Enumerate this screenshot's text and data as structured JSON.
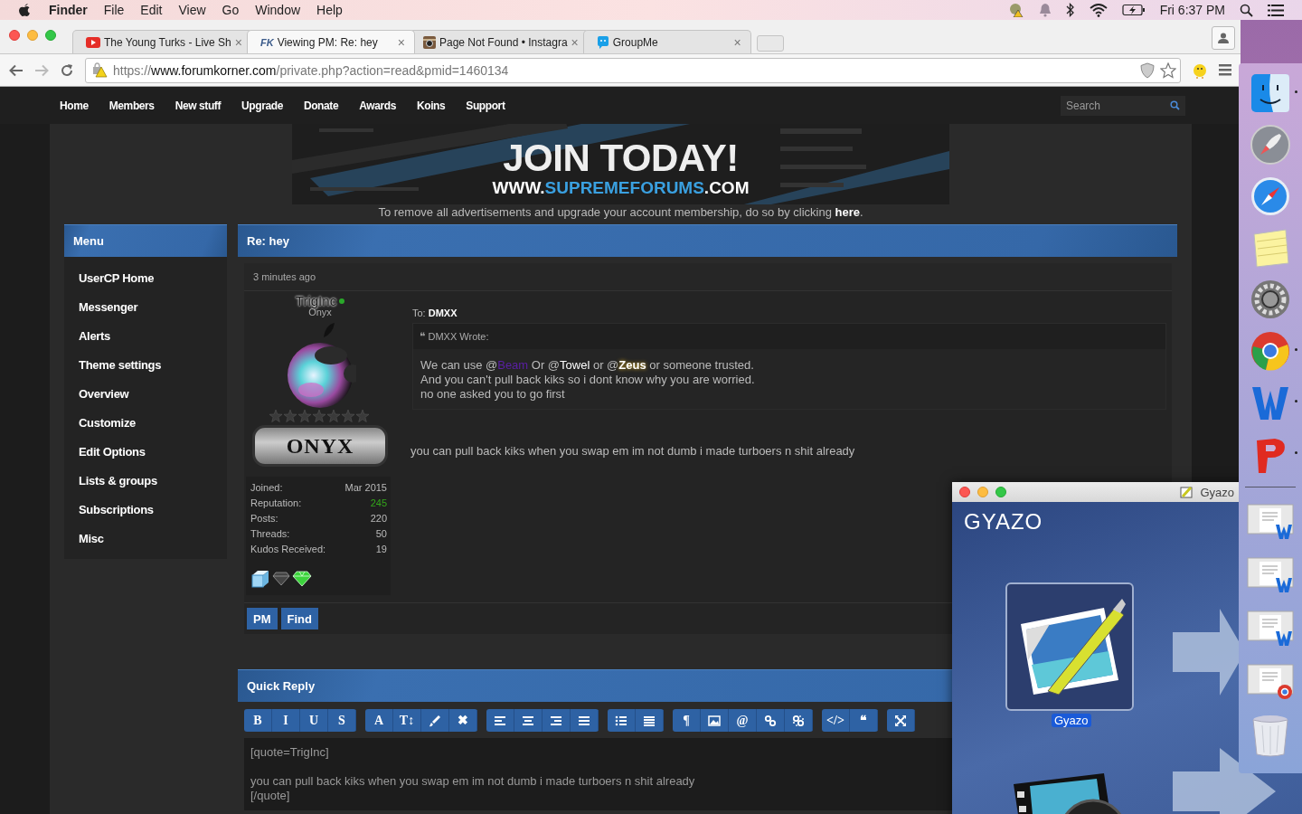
{
  "menubar": {
    "app": "Finder",
    "menus": [
      "File",
      "Edit",
      "View",
      "Go",
      "Window",
      "Help"
    ],
    "clock": "Fri 6:37 PM"
  },
  "browser": {
    "tabs": [
      {
        "title": "The Young Turks - Live Sh",
        "kind": "video",
        "close": "×",
        "selected": false
      },
      {
        "title": "Viewing PM: Re: hey",
        "kind": "monogram",
        "mark": "FK",
        "close": "×",
        "selected": true
      },
      {
        "title": "Page Not Found • Instagra",
        "kind": "camera",
        "close": "×",
        "selected": false
      },
      {
        "title": "GroupMe",
        "kind": "chat",
        "close": "×",
        "selected": false
      }
    ],
    "url": {
      "scheme": "https://",
      "host": "www.forumkorner.com",
      "path": "/private.php?action=read&pmid=1460134"
    }
  },
  "site": {
    "nav": [
      "Home",
      "Members",
      "New stuff",
      "Upgrade",
      "Donate",
      "Awards",
      "Koins",
      "Support"
    ],
    "search": {
      "placeholder": "Search"
    },
    "banner": {
      "headline": "JOIN TODAY!",
      "url_prefix": "WWW.",
      "url_name": "SUPREMEFORUMS",
      "url_suffix": ".COM"
    },
    "ad_notice": {
      "text": "To remove all advertisements and upgrade your account membership, do so by clicking ",
      "link": "here",
      "end": "."
    },
    "menu": {
      "title": "Menu",
      "items": [
        "UserCP Home",
        "Messenger",
        "Alerts",
        "Theme settings",
        "Overview",
        "Customize",
        "Edit Options",
        "Lists & groups",
        "Subscriptions",
        "Misc"
      ]
    },
    "message": {
      "title": "Re: hey",
      "time": "3 minutes ago",
      "author": {
        "name": "TrigInc",
        "online": true,
        "title": "Onyx",
        "rank_badge": "ONYX",
        "stats": [
          {
            "label": "Joined:",
            "value": "Mar 2015",
            "positive": false
          },
          {
            "label": "Reputation:",
            "value": "245",
            "positive": true
          },
          {
            "label": "Posts:",
            "value": "220",
            "positive": false
          },
          {
            "label": "Threads:",
            "value": "50",
            "positive": false
          },
          {
            "label": "Kudos Received:",
            "value": "19",
            "positive": false
          }
        ]
      },
      "to_label": "To:",
      "to": "DMXX",
      "quote": {
        "icon": "❝",
        "heading": "DMXX Wrote:",
        "lines": [
          [
            {
              "text": "We can use @",
              "kind": "plain"
            },
            {
              "text": "Beam",
              "kind": "mention",
              "color": "#5b1fa6",
              "glow": false
            },
            {
              "text": " Or @",
              "kind": "plain"
            },
            {
              "text": "Towel",
              "kind": "mention",
              "color": "#ffffff",
              "glow": false
            },
            {
              "text": " or @",
              "kind": "plain"
            },
            {
              "text": "Zeus",
              "kind": "mention",
              "color": "#ffffff",
              "glow": true
            },
            {
              "text": " or someone trusted.",
              "kind": "plain"
            }
          ],
          [
            {
              "text": "And you can't pull back kiks so i dont know why you are worried.",
              "kind": "plain"
            }
          ],
          [
            {
              "text": "no one asked you to go first",
              "kind": "plain"
            }
          ]
        ]
      },
      "body": "you can pull back kiks when you swap em im not dumb i made turboers n shit already",
      "buttons": [
        "PM",
        "Find"
      ]
    },
    "quick_reply": {
      "title": "Quick Reply",
      "toolbar": [
        [
          {
            "kind": "text",
            "label": "B"
          },
          {
            "kind": "text",
            "label": "I"
          },
          {
            "kind": "text",
            "label": "U"
          },
          {
            "kind": "text",
            "label": "S"
          }
        ],
        [
          {
            "kind": "text",
            "label": "A"
          },
          {
            "kind": "text",
            "label": "T↕"
          },
          {
            "kind": "icon"
          },
          {
            "kind": "text",
            "label": "✖"
          }
        ],
        [
          {
            "kind": "icon"
          },
          {
            "kind": "icon"
          },
          {
            "kind": "icon"
          },
          {
            "kind": "icon"
          }
        ],
        [
          {
            "kind": "icon"
          },
          {
            "kind": "icon"
          }
        ],
        [
          {
            "kind": "text",
            "label": "¶"
          },
          {
            "kind": "icon"
          },
          {
            "kind": "text",
            "label": "@"
          },
          {
            "kind": "icon"
          },
          {
            "kind": "icon"
          }
        ],
        [
          {
            "kind": "text",
            "label": "</>"
          },
          {
            "kind": "text",
            "label": "❝"
          }
        ],
        [
          {
            "kind": "icon"
          }
        ]
      ],
      "value": "[quote=TrigInc]\n\nyou can pull back kiks when you swap em im not dumb i made turboers n shit already\n[/quote]"
    }
  },
  "gyazo": {
    "title": "Gyazo",
    "logo": "GYAZO",
    "app_label": "Gyazo",
    "app_selected": true
  }
}
